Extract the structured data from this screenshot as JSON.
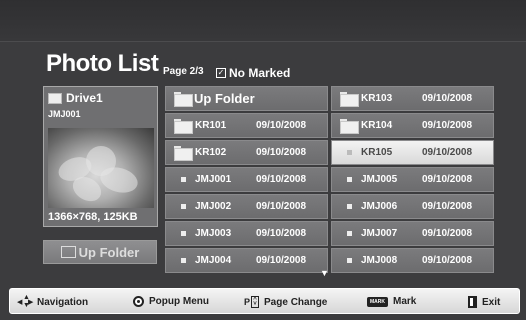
{
  "title": "Photo List",
  "page_info": "Page 2/3",
  "mark_status": "No Marked",
  "preview": {
    "drive": "Drive1",
    "file": "JMJ001",
    "size": "1366×768, 125KB"
  },
  "up_button": "Up Folder",
  "grid": {
    "left": [
      {
        "name": "Up Folder",
        "date": "",
        "type": "up"
      },
      {
        "name": "KR101",
        "date": "09/10/2008",
        "type": "folder"
      },
      {
        "name": "KR102",
        "date": "09/10/2008",
        "type": "folder"
      },
      {
        "name": "JMJ001",
        "date": "09/10/2008",
        "type": "file"
      },
      {
        "name": "JMJ002",
        "date": "09/10/2008",
        "type": "file"
      },
      {
        "name": "JMJ003",
        "date": "09/10/2008",
        "type": "file"
      },
      {
        "name": "JMJ004",
        "date": "09/10/2008",
        "type": "file"
      }
    ],
    "right": [
      {
        "name": "KR103",
        "date": "09/10/2008",
        "type": "folder"
      },
      {
        "name": "KR104",
        "date": "09/10/2008",
        "type": "folder"
      },
      {
        "name": "KR105",
        "date": "09/10/2008",
        "type": "file",
        "selected": true
      },
      {
        "name": "JMJ005",
        "date": "09/10/2008",
        "type": "file"
      },
      {
        "name": "JMJ006",
        "date": "09/10/2008",
        "type": "file"
      },
      {
        "name": "JMJ007",
        "date": "09/10/2008",
        "type": "file"
      },
      {
        "name": "JMJ008",
        "date": "09/10/2008",
        "type": "file"
      }
    ]
  },
  "bottombar": {
    "navigation": "Navigation",
    "popup_menu": "Popup Menu",
    "page_change": "Page Change",
    "mark": "Mark",
    "exit": "Exit",
    "mark_key": "MARK",
    "page_key": "P"
  }
}
